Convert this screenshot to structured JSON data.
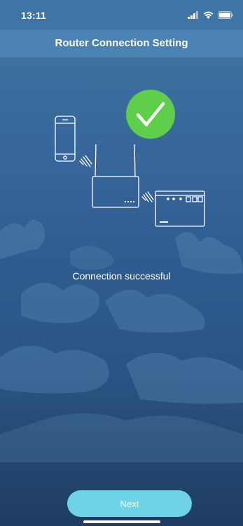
{
  "status_bar": {
    "time": "13:11",
    "icons": [
      "cellular-signal-icon",
      "wifi-icon",
      "battery-icon"
    ]
  },
  "nav": {
    "title": "Router Connection Setting"
  },
  "illustration": {
    "icons": [
      "phone-icon",
      "router-icon",
      "aquarium-controller-icon",
      "success-check-icon",
      "wireless-signal-icon"
    ],
    "colors": {
      "check_circle": "#5fcf4a",
      "line": "#ffffff"
    }
  },
  "status_message": "Connection successful",
  "next_button": {
    "label": "Next",
    "color": "#6fd3e7"
  }
}
